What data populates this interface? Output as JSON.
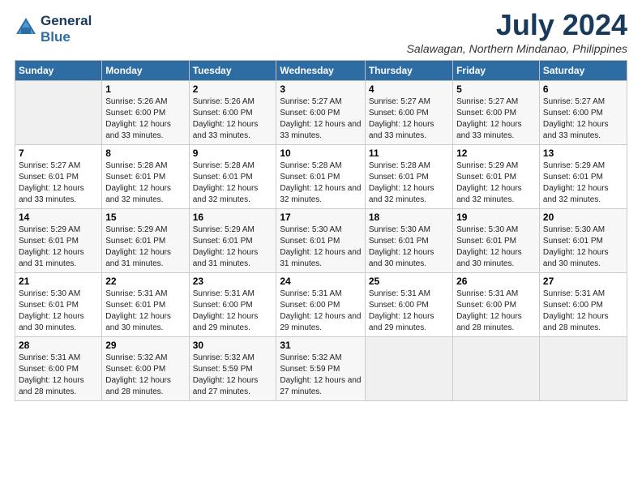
{
  "header": {
    "logo_line1": "General",
    "logo_line2": "Blue",
    "month_year": "July 2024",
    "location": "Salawagan, Northern Mindanao, Philippines"
  },
  "days_of_week": [
    "Sunday",
    "Monday",
    "Tuesday",
    "Wednesday",
    "Thursday",
    "Friday",
    "Saturday"
  ],
  "weeks": [
    [
      {
        "num": "",
        "sunrise": "",
        "sunset": "",
        "daylight": ""
      },
      {
        "num": "1",
        "sunrise": "Sunrise: 5:26 AM",
        "sunset": "Sunset: 6:00 PM",
        "daylight": "Daylight: 12 hours and 33 minutes."
      },
      {
        "num": "2",
        "sunrise": "Sunrise: 5:26 AM",
        "sunset": "Sunset: 6:00 PM",
        "daylight": "Daylight: 12 hours and 33 minutes."
      },
      {
        "num": "3",
        "sunrise": "Sunrise: 5:27 AM",
        "sunset": "Sunset: 6:00 PM",
        "daylight": "Daylight: 12 hours and 33 minutes."
      },
      {
        "num": "4",
        "sunrise": "Sunrise: 5:27 AM",
        "sunset": "Sunset: 6:00 PM",
        "daylight": "Daylight: 12 hours and 33 minutes."
      },
      {
        "num": "5",
        "sunrise": "Sunrise: 5:27 AM",
        "sunset": "Sunset: 6:00 PM",
        "daylight": "Daylight: 12 hours and 33 minutes."
      },
      {
        "num": "6",
        "sunrise": "Sunrise: 5:27 AM",
        "sunset": "Sunset: 6:00 PM",
        "daylight": "Daylight: 12 hours and 33 minutes."
      }
    ],
    [
      {
        "num": "7",
        "sunrise": "Sunrise: 5:27 AM",
        "sunset": "Sunset: 6:01 PM",
        "daylight": "Daylight: 12 hours and 33 minutes."
      },
      {
        "num": "8",
        "sunrise": "Sunrise: 5:28 AM",
        "sunset": "Sunset: 6:01 PM",
        "daylight": "Daylight: 12 hours and 32 minutes."
      },
      {
        "num": "9",
        "sunrise": "Sunrise: 5:28 AM",
        "sunset": "Sunset: 6:01 PM",
        "daylight": "Daylight: 12 hours and 32 minutes."
      },
      {
        "num": "10",
        "sunrise": "Sunrise: 5:28 AM",
        "sunset": "Sunset: 6:01 PM",
        "daylight": "Daylight: 12 hours and 32 minutes."
      },
      {
        "num": "11",
        "sunrise": "Sunrise: 5:28 AM",
        "sunset": "Sunset: 6:01 PM",
        "daylight": "Daylight: 12 hours and 32 minutes."
      },
      {
        "num": "12",
        "sunrise": "Sunrise: 5:29 AM",
        "sunset": "Sunset: 6:01 PM",
        "daylight": "Daylight: 12 hours and 32 minutes."
      },
      {
        "num": "13",
        "sunrise": "Sunrise: 5:29 AM",
        "sunset": "Sunset: 6:01 PM",
        "daylight": "Daylight: 12 hours and 32 minutes."
      }
    ],
    [
      {
        "num": "14",
        "sunrise": "Sunrise: 5:29 AM",
        "sunset": "Sunset: 6:01 PM",
        "daylight": "Daylight: 12 hours and 31 minutes."
      },
      {
        "num": "15",
        "sunrise": "Sunrise: 5:29 AM",
        "sunset": "Sunset: 6:01 PM",
        "daylight": "Daylight: 12 hours and 31 minutes."
      },
      {
        "num": "16",
        "sunrise": "Sunrise: 5:29 AM",
        "sunset": "Sunset: 6:01 PM",
        "daylight": "Daylight: 12 hours and 31 minutes."
      },
      {
        "num": "17",
        "sunrise": "Sunrise: 5:30 AM",
        "sunset": "Sunset: 6:01 PM",
        "daylight": "Daylight: 12 hours and 31 minutes."
      },
      {
        "num": "18",
        "sunrise": "Sunrise: 5:30 AM",
        "sunset": "Sunset: 6:01 PM",
        "daylight": "Daylight: 12 hours and 30 minutes."
      },
      {
        "num": "19",
        "sunrise": "Sunrise: 5:30 AM",
        "sunset": "Sunset: 6:01 PM",
        "daylight": "Daylight: 12 hours and 30 minutes."
      },
      {
        "num": "20",
        "sunrise": "Sunrise: 5:30 AM",
        "sunset": "Sunset: 6:01 PM",
        "daylight": "Daylight: 12 hours and 30 minutes."
      }
    ],
    [
      {
        "num": "21",
        "sunrise": "Sunrise: 5:30 AM",
        "sunset": "Sunset: 6:01 PM",
        "daylight": "Daylight: 12 hours and 30 minutes."
      },
      {
        "num": "22",
        "sunrise": "Sunrise: 5:31 AM",
        "sunset": "Sunset: 6:01 PM",
        "daylight": "Daylight: 12 hours and 30 minutes."
      },
      {
        "num": "23",
        "sunrise": "Sunrise: 5:31 AM",
        "sunset": "Sunset: 6:00 PM",
        "daylight": "Daylight: 12 hours and 29 minutes."
      },
      {
        "num": "24",
        "sunrise": "Sunrise: 5:31 AM",
        "sunset": "Sunset: 6:00 PM",
        "daylight": "Daylight: 12 hours and 29 minutes."
      },
      {
        "num": "25",
        "sunrise": "Sunrise: 5:31 AM",
        "sunset": "Sunset: 6:00 PM",
        "daylight": "Daylight: 12 hours and 29 minutes."
      },
      {
        "num": "26",
        "sunrise": "Sunrise: 5:31 AM",
        "sunset": "Sunset: 6:00 PM",
        "daylight": "Daylight: 12 hours and 28 minutes."
      },
      {
        "num": "27",
        "sunrise": "Sunrise: 5:31 AM",
        "sunset": "Sunset: 6:00 PM",
        "daylight": "Daylight: 12 hours and 28 minutes."
      }
    ],
    [
      {
        "num": "28",
        "sunrise": "Sunrise: 5:31 AM",
        "sunset": "Sunset: 6:00 PM",
        "daylight": "Daylight: 12 hours and 28 minutes."
      },
      {
        "num": "29",
        "sunrise": "Sunrise: 5:32 AM",
        "sunset": "Sunset: 6:00 PM",
        "daylight": "Daylight: 12 hours and 28 minutes."
      },
      {
        "num": "30",
        "sunrise": "Sunrise: 5:32 AM",
        "sunset": "Sunset: 5:59 PM",
        "daylight": "Daylight: 12 hours and 27 minutes."
      },
      {
        "num": "31",
        "sunrise": "Sunrise: 5:32 AM",
        "sunset": "Sunset: 5:59 PM",
        "daylight": "Daylight: 12 hours and 27 minutes."
      },
      {
        "num": "",
        "sunrise": "",
        "sunset": "",
        "daylight": ""
      },
      {
        "num": "",
        "sunrise": "",
        "sunset": "",
        "daylight": ""
      },
      {
        "num": "",
        "sunrise": "",
        "sunset": "",
        "daylight": ""
      }
    ]
  ]
}
